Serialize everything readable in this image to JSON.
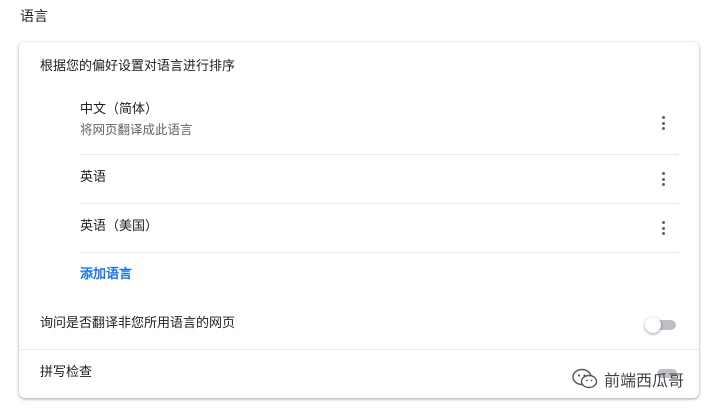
{
  "section": {
    "title": "语言"
  },
  "card": {
    "header": "根据您的偏好设置对语言进行排序",
    "languages": [
      {
        "name": "中文（简体）",
        "subtitle": "将网页翻译成此语言"
      },
      {
        "name": "英语",
        "subtitle": ""
      },
      {
        "name": "英语（美国）",
        "subtitle": ""
      }
    ],
    "add_language_label": "添加语言",
    "offer_translate": {
      "label": "询问是否翻译非您所用语言的网页",
      "enabled": false
    },
    "spell_check": {
      "label": "拼写检查"
    }
  },
  "watermark": {
    "text": "前端西瓜哥",
    "icon": "wechat-icon"
  },
  "colors": {
    "accent": "#1a73e8",
    "text_primary": "#202124",
    "text_secondary": "#5f6368",
    "divider": "#e8eaed",
    "toggle_off_track": "#bdc1c6"
  }
}
